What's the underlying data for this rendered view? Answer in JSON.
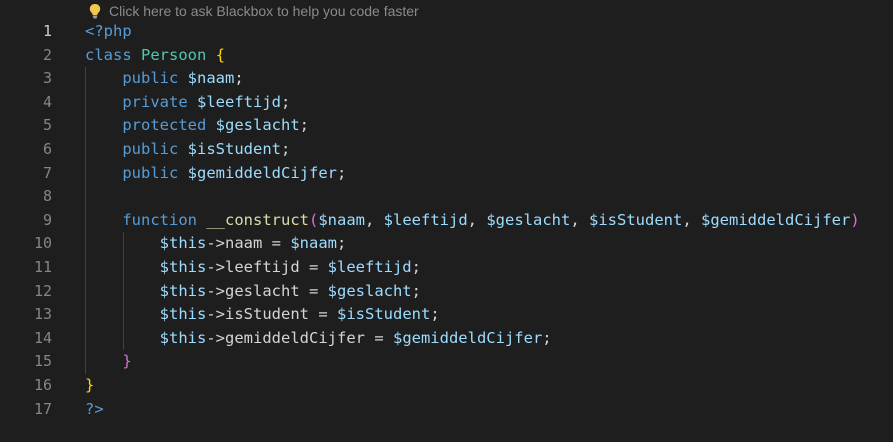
{
  "hint": {
    "icon": "lightbulb-icon",
    "text": "Click here to ask Blackbox to help you code faster"
  },
  "active_line": 1,
  "lines": [
    {
      "number": "1",
      "tokens": [
        {
          "t": "<?php",
          "c": "tag"
        }
      ]
    },
    {
      "number": "2",
      "tokens": [
        {
          "t": "class",
          "c": "kw"
        },
        {
          "t": " ",
          "c": "op"
        },
        {
          "t": "Persoon",
          "c": "cls"
        },
        {
          "t": " ",
          "c": "op"
        },
        {
          "t": "{",
          "c": "b1"
        }
      ]
    },
    {
      "number": "3",
      "tokens": [
        {
          "t": "    ",
          "c": "op"
        },
        {
          "t": "public",
          "c": "kw"
        },
        {
          "t": " ",
          "c": "op"
        },
        {
          "t": "$naam",
          "c": "var"
        },
        {
          "t": ";",
          "c": "op"
        }
      ]
    },
    {
      "number": "4",
      "tokens": [
        {
          "t": "    ",
          "c": "op"
        },
        {
          "t": "private",
          "c": "kw"
        },
        {
          "t": " ",
          "c": "op"
        },
        {
          "t": "$leeftijd",
          "c": "var"
        },
        {
          "t": ";",
          "c": "op"
        }
      ]
    },
    {
      "number": "5",
      "tokens": [
        {
          "t": "    ",
          "c": "op"
        },
        {
          "t": "protected",
          "c": "kw"
        },
        {
          "t": " ",
          "c": "op"
        },
        {
          "t": "$geslacht",
          "c": "var"
        },
        {
          "t": ";",
          "c": "op"
        }
      ]
    },
    {
      "number": "6",
      "tokens": [
        {
          "t": "    ",
          "c": "op"
        },
        {
          "t": "public",
          "c": "kw"
        },
        {
          "t": " ",
          "c": "op"
        },
        {
          "t": "$isStudent",
          "c": "var"
        },
        {
          "t": ";",
          "c": "op"
        }
      ]
    },
    {
      "number": "7",
      "tokens": [
        {
          "t": "    ",
          "c": "op"
        },
        {
          "t": "public",
          "c": "kw"
        },
        {
          "t": " ",
          "c": "op"
        },
        {
          "t": "$gemiddeldCijfer",
          "c": "var"
        },
        {
          "t": ";",
          "c": "op"
        }
      ]
    },
    {
      "number": "8",
      "tokens": []
    },
    {
      "number": "9",
      "tokens": [
        {
          "t": "    ",
          "c": "op"
        },
        {
          "t": "function",
          "c": "kw"
        },
        {
          "t": " ",
          "c": "op"
        },
        {
          "t": "__construct",
          "c": "fn"
        },
        {
          "t": "(",
          "c": "b2"
        },
        {
          "t": "$naam",
          "c": "var"
        },
        {
          "t": ", ",
          "c": "op"
        },
        {
          "t": "$leeftijd",
          "c": "var"
        },
        {
          "t": ", ",
          "c": "op"
        },
        {
          "t": "$geslacht",
          "c": "var"
        },
        {
          "t": ", ",
          "c": "op"
        },
        {
          "t": "$isStudent",
          "c": "var"
        },
        {
          "t": ", ",
          "c": "op"
        },
        {
          "t": "$gemiddeldCijfer",
          "c": "var"
        },
        {
          "t": ")",
          "c": "b2"
        }
      ]
    },
    {
      "number": "10",
      "tokens": [
        {
          "t": "        ",
          "c": "op"
        },
        {
          "t": "$this",
          "c": "var"
        },
        {
          "t": "->",
          "c": "op"
        },
        {
          "t": "naam",
          "c": "op"
        },
        {
          "t": " = ",
          "c": "op"
        },
        {
          "t": "$naam",
          "c": "var"
        },
        {
          "t": ";",
          "c": "op"
        }
      ]
    },
    {
      "number": "11",
      "tokens": [
        {
          "t": "        ",
          "c": "op"
        },
        {
          "t": "$this",
          "c": "var"
        },
        {
          "t": "->",
          "c": "op"
        },
        {
          "t": "leeftijd",
          "c": "op"
        },
        {
          "t": " = ",
          "c": "op"
        },
        {
          "t": "$leeftijd",
          "c": "var"
        },
        {
          "t": ";",
          "c": "op"
        }
      ]
    },
    {
      "number": "12",
      "tokens": [
        {
          "t": "        ",
          "c": "op"
        },
        {
          "t": "$this",
          "c": "var"
        },
        {
          "t": "->",
          "c": "op"
        },
        {
          "t": "geslacht",
          "c": "op"
        },
        {
          "t": " = ",
          "c": "op"
        },
        {
          "t": "$geslacht",
          "c": "var"
        },
        {
          "t": ";",
          "c": "op"
        }
      ]
    },
    {
      "number": "13",
      "tokens": [
        {
          "t": "        ",
          "c": "op"
        },
        {
          "t": "$this",
          "c": "var"
        },
        {
          "t": "->",
          "c": "op"
        },
        {
          "t": "isStudent",
          "c": "op"
        },
        {
          "t": " = ",
          "c": "op"
        },
        {
          "t": "$isStudent",
          "c": "var"
        },
        {
          "t": ";",
          "c": "op"
        }
      ]
    },
    {
      "number": "14",
      "tokens": [
        {
          "t": "        ",
          "c": "op"
        },
        {
          "t": "$this",
          "c": "var"
        },
        {
          "t": "->",
          "c": "op"
        },
        {
          "t": "gemiddeldCijfer",
          "c": "op"
        },
        {
          "t": " = ",
          "c": "op"
        },
        {
          "t": "$gemiddeldCijfer",
          "c": "var"
        },
        {
          "t": ";",
          "c": "op"
        }
      ]
    },
    {
      "number": "15",
      "tokens": [
        {
          "t": "    ",
          "c": "op"
        },
        {
          "t": "}",
          "c": "b2"
        }
      ]
    },
    {
      "number": "16",
      "tokens": [
        {
          "t": "}",
          "c": "b1"
        }
      ]
    },
    {
      "number": "17",
      "tokens": [
        {
          "t": "?>",
          "c": "tag"
        }
      ]
    }
  ]
}
